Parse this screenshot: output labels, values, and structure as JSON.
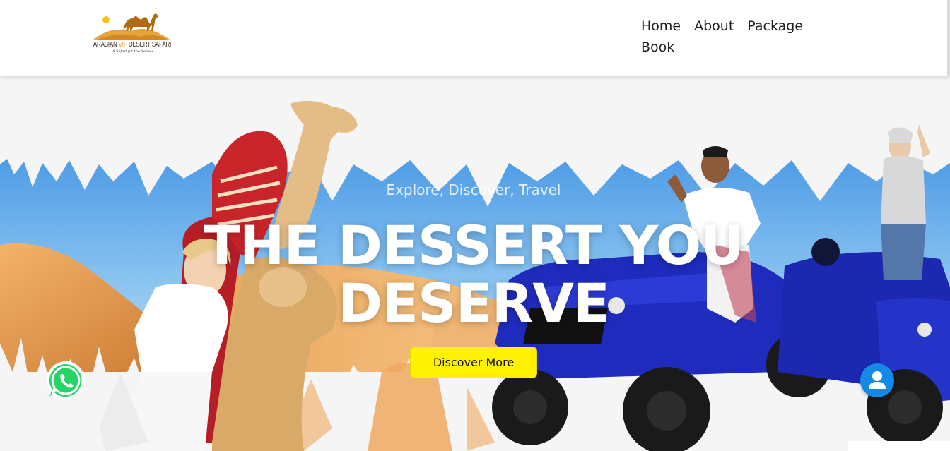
{
  "header": {
    "logo": {
      "name_part1": "ARABIAN ",
      "name_part2": "VIP",
      "name_part3": " DESERT SAFARI",
      "tagline": "A Safari for the Senses"
    },
    "nav": [
      {
        "label": "Home"
      },
      {
        "label": "About"
      },
      {
        "label": "Package"
      },
      {
        "label": "Book"
      }
    ]
  },
  "hero": {
    "subtitle": "Explore, Discover, Travel",
    "title": "THE DESSERT YOU DESERVE",
    "cta_label": "Discover More"
  },
  "floating": {
    "whatsapp_icon": "whatsapp-icon",
    "user_icon": "user-icon"
  },
  "colors": {
    "sky": "#6fb2ee",
    "sand": "#f0a860",
    "cta": "#fff200",
    "user_button": "#1489e6",
    "whatsapp": "#25d366",
    "logo_accent": "#e49b1b"
  }
}
